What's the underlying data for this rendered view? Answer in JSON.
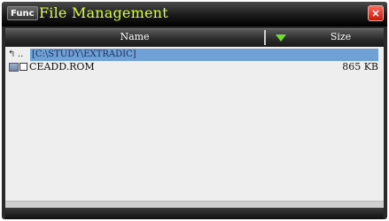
{
  "window": {
    "func_label": "Func",
    "title": "File Management",
    "close_label": "×"
  },
  "columns": {
    "name": "Name",
    "size": "Size"
  },
  "list": {
    "up_label": "..",
    "current_path": "[C:\\STUDY\\EXTRADIC]",
    "files": [
      {
        "name": "CEADD.ROM",
        "size": "865 KB"
      }
    ]
  },
  "colors": {
    "title": "#d8ff3a",
    "path_highlight": "#6fa0d6",
    "sort_arrow": "#6fe02a",
    "close": "#c21808"
  },
  "icons": {
    "up": "up-folder-icon",
    "file": "rom-file-icon",
    "sort": "sort-descending-icon"
  }
}
